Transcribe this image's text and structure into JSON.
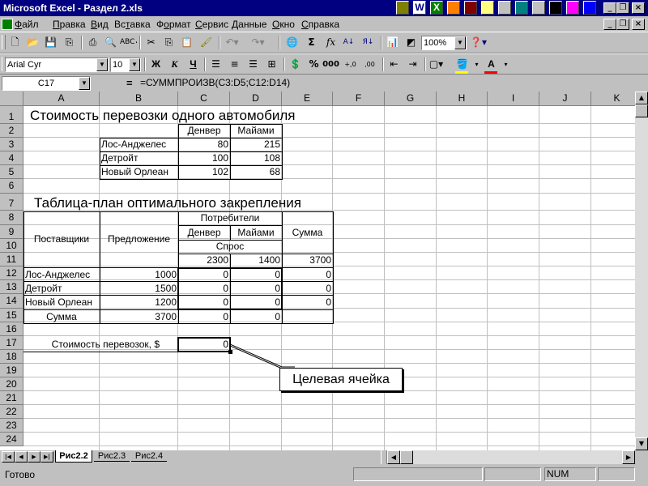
{
  "window": {
    "title": "Microsoft Excel - Раздел 2.xls"
  },
  "menu": [
    "Файл",
    "Правка",
    "Вид",
    "Вставка",
    "Формат",
    "Сервис",
    "Данные",
    "Окно",
    "Справка"
  ],
  "menu_hotkeys": [
    "Ф",
    "П",
    "В",
    "т",
    "о",
    "С",
    "Д",
    "О",
    "С"
  ],
  "toolbar": {
    "zoom": "100%",
    "font_name": "Arial Cyr",
    "font_size": "10",
    "bold": "Ж",
    "italic": "К",
    "underline": "Ч"
  },
  "formula_bar": {
    "name_box": "C17",
    "equals": "=",
    "formula": "=СУММПРОИЗВ(C3:D5;C12:D14)"
  },
  "columns": [
    "A",
    "B",
    "C",
    "D",
    "E",
    "F",
    "G",
    "H",
    "I",
    "J",
    "K"
  ],
  "rows": [
    "1",
    "2",
    "3",
    "4",
    "5",
    "6",
    "7",
    "8",
    "9",
    "10",
    "11",
    "12",
    "13",
    "14",
    "15",
    "16",
    "17",
    "18",
    "19",
    "20",
    "21",
    "22",
    "23",
    "24"
  ],
  "sheet": {
    "title1": "Стоимость перевозки одного автомобиля",
    "cost_table": {
      "headers": [
        "Денвер",
        "Майами"
      ],
      "rows": [
        {
          "city": "Лос-Анджелес",
          "values": [
            "80",
            "215"
          ]
        },
        {
          "city": "Детройт",
          "values": [
            "100",
            "108"
          ]
        },
        {
          "city": "Новый Орлеан",
          "values": [
            "102",
            "68"
          ]
        }
      ]
    },
    "title2": "Таблица-план оптимального закрепления",
    "plan_table": {
      "suppliers_header": "Поставщики",
      "supply_header": "Предложение",
      "consumers_header": "Потребители",
      "consumer_names": [
        "Денвер",
        "Майами"
      ],
      "demand_header": "Спрос",
      "sum_header": "Сумма",
      "demand_values": [
        "2300",
        "1400"
      ],
      "demand_total": "3700",
      "rows": [
        {
          "name": "Лос-Анджелес",
          "supply": "1000",
          "values": [
            "0",
            "0"
          ],
          "sum": "0"
        },
        {
          "name": "Детройт",
          "supply": "1500",
          "values": [
            "0",
            "0"
          ],
          "sum": "0"
        },
        {
          "name": "Новый Орлеан",
          "supply": "1200",
          "values": [
            "0",
            "0"
          ],
          "sum": "0"
        }
      ],
      "total_label": "Сумма",
      "total_supply": "3700",
      "total_values": [
        "0",
        "0"
      ]
    },
    "cost_label": "Стоимость перевозок, $",
    "cost_value": "0",
    "callout": "Целевая ячейка"
  },
  "sheet_tabs": [
    "Рис2.2",
    "Рис2.3",
    "Рис2.4"
  ],
  "active_tab": "Рис2.2",
  "status": {
    "ready": "Готово",
    "num": "NUM"
  }
}
